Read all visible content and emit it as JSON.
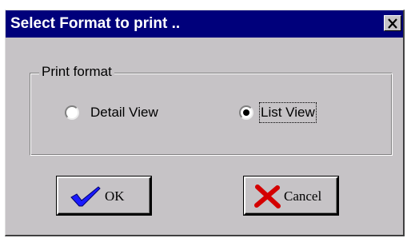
{
  "dialog": {
    "title": "Select Format to print ..",
    "close_glyph": "×"
  },
  "print_format": {
    "label": "Print format",
    "options": [
      {
        "label": "Detail View",
        "selected": false
      },
      {
        "label": "List View",
        "selected": true
      }
    ]
  },
  "buttons": {
    "ok_label": "OK",
    "cancel_label": "Cancel"
  },
  "colors": {
    "titlebar": "#00007b",
    "face": "#c6c3c6",
    "check_blue": "#1a1aff",
    "cross_red": "#d40000"
  },
  "icons": {
    "ok": "check-icon",
    "cancel": "cross-icon",
    "close": "close-icon"
  }
}
